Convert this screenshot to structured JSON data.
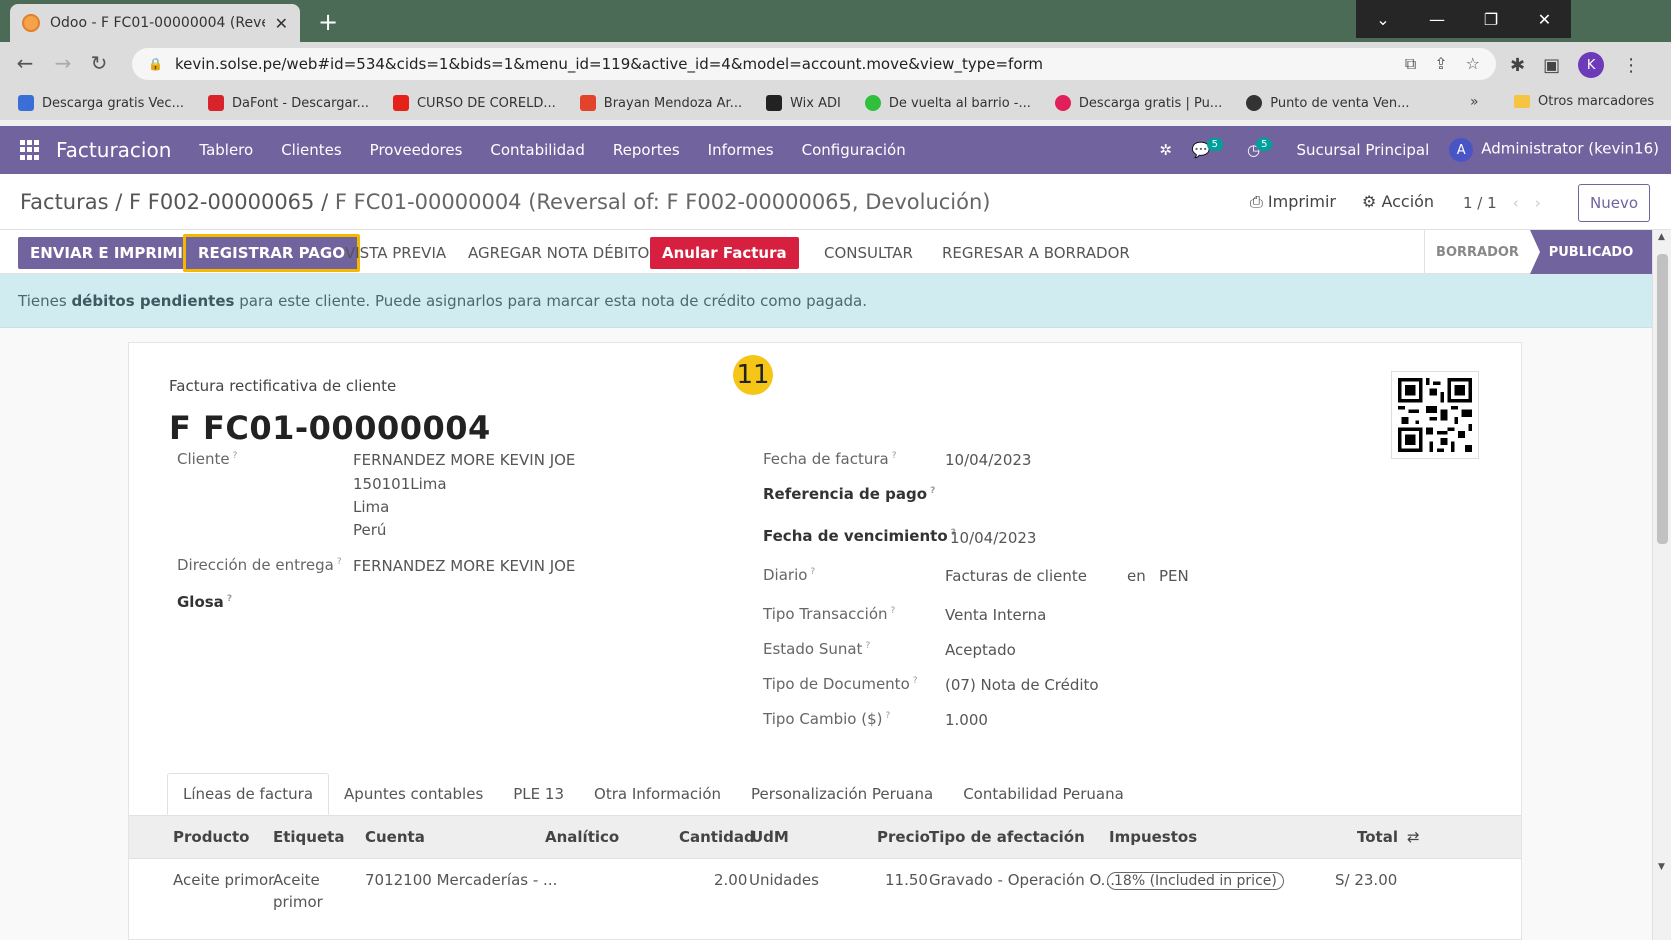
{
  "browser": {
    "tab_title": "Odoo - F FC01-00000004 (Rever",
    "url": "kevin.solse.pe/web#id=534&cids=1&bids=1&menu_id=119&active_id=4&model=account.move&view_type=form",
    "bookmarks": [
      {
        "label": "Descarga gratis Vec...",
        "color": "#3b6fd8"
      },
      {
        "label": "DaFont - Descargar...",
        "color": "#d8232a"
      },
      {
        "label": "CURSO DE CORELD...",
        "color": "#e62117"
      },
      {
        "label": "Brayan Mendoza Ar...",
        "color": "#e2432a"
      },
      {
        "label": "Wix ADI",
        "color": "#222222"
      },
      {
        "label": "De vuelta al barrio -...",
        "color": "#2fbf3c"
      },
      {
        "label": "Descarga gratis | Pu...",
        "color": "#e01f5b"
      },
      {
        "label": "Punto de venta Ven...",
        "color": "#333333"
      }
    ],
    "bookmarks_more": "»",
    "other_bookmarks": "Otros marcadores",
    "profile_initial": "K"
  },
  "nav": {
    "app_name": "Facturacion",
    "menu": [
      "Tablero",
      "Clientes",
      "Proveedores",
      "Contabilidad",
      "Reportes",
      "Informes",
      "Configuración"
    ],
    "messages_count": "5",
    "activities_count": "5",
    "company": "Sucursal Principal",
    "user_initial": "A",
    "user": "Administrator (kevin16)"
  },
  "control_panel": {
    "crumb1": "Facturas",
    "crumb2": "F F002-00000065",
    "current": "F FC01-00000004 (Reversal of: F F002-00000065, Devolución)",
    "print": "Imprimir",
    "action": "Acción",
    "pager": "1 / 1",
    "new_button": "Nuevo"
  },
  "statusbar": {
    "send_print": "ENVIAR E IMPRIMIR",
    "register_payment": "REGISTRAR PAGO",
    "preview": "VISTA PREVIA",
    "debit_note": "AGREGAR NOTA DÉBITO",
    "cancel_invoice": "Anular Factura",
    "consult": "CONSULTAR",
    "reset_draft": "REGRESAR A BORRADOR",
    "stage_draft": "BORRADOR",
    "stage_posted": "PUBLICADO"
  },
  "alert": {
    "prefix": "Tienes ",
    "bold": "débitos pendientes",
    "suffix": " para este cliente. Puede asignarlos para marcar esta nota de crédito como pagada."
  },
  "form": {
    "doc_type": "Factura rectificativa de cliente",
    "doc_name": "F FC01-00000004",
    "step_badge": "11",
    "left": {
      "cliente_label": "Cliente",
      "cliente_name": "FERNANDEZ MORE KEVIN JOE",
      "cliente_addr1": "150101Lima",
      "cliente_addr2": "Lima",
      "cliente_addr3": "Perú",
      "entrega_label": "Dirección de entrega",
      "entrega_value": "FERNANDEZ MORE KEVIN JOE",
      "glosa_label": "Glosa"
    },
    "right": {
      "fecha_factura_label": "Fecha de factura",
      "fecha_factura": "10/04/2023",
      "referencia_label": "Referencia de pago",
      "vencimiento_label": "Fecha de vencimiento",
      "vencimiento": "10/04/2023",
      "diario_label": "Diario",
      "diario": "Facturas de cliente",
      "en": "en",
      "currency": "PEN",
      "tipo_transaccion_label": "Tipo Transacción",
      "tipo_transaccion": "Venta Interna",
      "estado_sunat_label": "Estado Sunat",
      "estado_sunat": "Aceptado",
      "tipo_documento_label": "Tipo de Documento",
      "tipo_documento": "(07) Nota de Crédito",
      "tipo_cambio_label": "Tipo Cambio ($)",
      "tipo_cambio": "1.000"
    },
    "help_mark": "?",
    "tabs": [
      "Líneas de factura",
      "Apuntes contables",
      "PLE 13",
      "Otra Información",
      "Personalización Peruana",
      "Contabilidad Peruana"
    ],
    "columns": {
      "producto": "Producto",
      "etiqueta": "Etiqueta",
      "cuenta": "Cuenta",
      "analitico": "Analítico",
      "cantidad": "Cantidad",
      "udm": "UdM",
      "precio": "Precio",
      "afectacion": "Tipo de afectación",
      "impuestos": "Impuestos",
      "total": "Total"
    },
    "line": {
      "producto": "Aceite primor",
      "etiqueta1": "Aceite",
      "etiqueta2": "primor",
      "cuenta": "7012100 Mercaderías - ...",
      "cantidad": "2.00",
      "udm": "Unidades",
      "precio": "11.50",
      "afectacion": "Gravado - Operación O...",
      "impuesto": "18% (Included in price)",
      "total": "S/ 23.00"
    }
  }
}
